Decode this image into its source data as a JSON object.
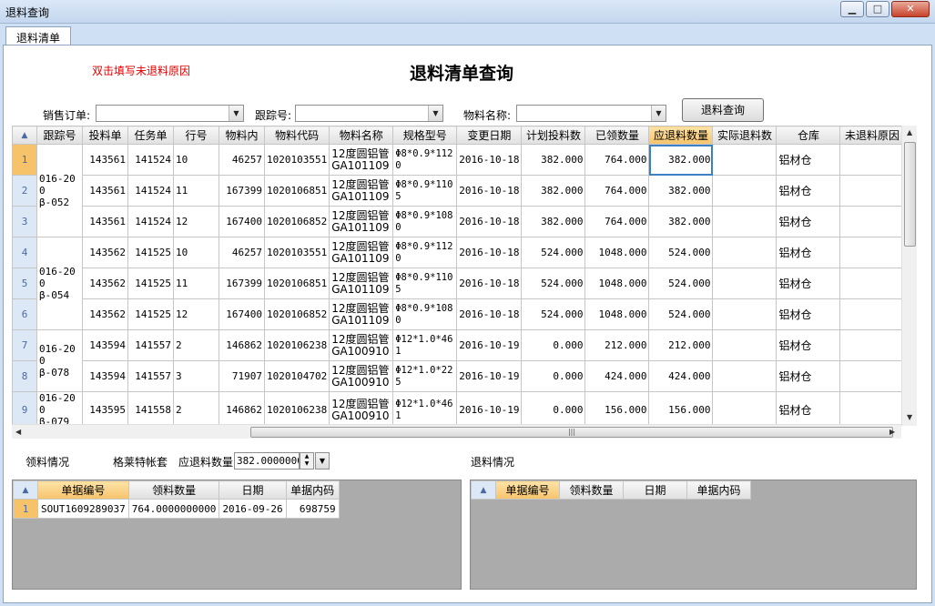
{
  "window": {
    "title": "退料查询"
  },
  "tabs": [
    {
      "label": "退料清单"
    }
  ],
  "hint_text": "双击填写未退料原因",
  "page_title": "退料清单查询",
  "filters": {
    "sales_order_label": "销售订单:",
    "sales_order_value": "",
    "tracking_label": "跟踪号:",
    "tracking_value": "",
    "material_name_label": "物料名称:",
    "material_name_value": "",
    "query_button": "退料查询"
  },
  "main_grid": {
    "columns": [
      "跟踪号",
      "投料单",
      "任务单",
      "行号",
      "物料内",
      "物料代码",
      "物料名称",
      "规格型号",
      "变更日期",
      "计划投料数",
      "已领数量",
      "应退料数量",
      "实际退料数",
      "仓库",
      "未退料原因"
    ],
    "groups": [
      {
        "tracking": "016-200\nβ-052",
        "row_start": 0,
        "span": 3
      },
      {
        "tracking": "016-200\nβ-054",
        "row_start": 3,
        "span": 3
      },
      {
        "tracking": "016-200\nβ-078",
        "row_start": 6,
        "span": 2
      },
      {
        "tracking": "016-200\nβ-079",
        "row_start": 8,
        "span": 1
      }
    ],
    "rows": [
      {
        "n": "1",
        "feed": "143561",
        "task": "141524",
        "line": "10",
        "inner": "46257",
        "code": "1020103551",
        "name": "12度圆铝管GA101109",
        "spec": "Φ8*0.9*1120",
        "date": "2016-10-18",
        "plan": "382.000",
        "taken": "764.000",
        "should": "382.000",
        "actual": "",
        "wh": "铝材仓",
        "reason": ""
      },
      {
        "n": "2",
        "feed": "143561",
        "task": "141524",
        "line": "11",
        "inner": "167399",
        "code": "1020106851",
        "name": "12度圆铝管GA101109",
        "spec": "Φ8*0.9*1105",
        "date": "2016-10-18",
        "plan": "382.000",
        "taken": "764.000",
        "should": "382.000",
        "actual": "",
        "wh": "铝材仓",
        "reason": ""
      },
      {
        "n": "3",
        "feed": "143561",
        "task": "141524",
        "line": "12",
        "inner": "167400",
        "code": "1020106852",
        "name": "12度圆铝管GA101109",
        "spec": "Φ8*0.9*1080",
        "date": "2016-10-18",
        "plan": "382.000",
        "taken": "764.000",
        "should": "382.000",
        "actual": "",
        "wh": "铝材仓",
        "reason": ""
      },
      {
        "n": "4",
        "feed": "143562",
        "task": "141525",
        "line": "10",
        "inner": "46257",
        "code": "1020103551",
        "name": "12度圆铝管GA101109",
        "spec": "Φ8*0.9*1120",
        "date": "2016-10-18",
        "plan": "524.000",
        "taken": "1048.000",
        "should": "524.000",
        "actual": "",
        "wh": "铝材仓",
        "reason": ""
      },
      {
        "n": "5",
        "feed": "143562",
        "task": "141525",
        "line": "11",
        "inner": "167399",
        "code": "1020106851",
        "name": "12度圆铝管GA101109",
        "spec": "Φ8*0.9*1105",
        "date": "2016-10-18",
        "plan": "524.000",
        "taken": "1048.000",
        "should": "524.000",
        "actual": "",
        "wh": "铝材仓",
        "reason": ""
      },
      {
        "n": "6",
        "feed": "143562",
        "task": "141525",
        "line": "12",
        "inner": "167400",
        "code": "1020106852",
        "name": "12度圆铝管GA101109",
        "spec": "Φ8*0.9*1080",
        "date": "2016-10-18",
        "plan": "524.000",
        "taken": "1048.000",
        "should": "524.000",
        "actual": "",
        "wh": "铝材仓",
        "reason": ""
      },
      {
        "n": "7",
        "feed": "143594",
        "task": "141557",
        "line": "2",
        "inner": "146862",
        "code": "1020106238",
        "name": "12度圆铝管GA100910",
        "spec": "Φ12*1.0*461",
        "date": "2016-10-19",
        "plan": "0.000",
        "taken": "212.000",
        "should": "212.000",
        "actual": "",
        "wh": "铝材仓",
        "reason": ""
      },
      {
        "n": "8",
        "feed": "143594",
        "task": "141557",
        "line": "3",
        "inner": "71907",
        "code": "1020104702",
        "name": "12度圆铝管GA100910",
        "spec": "Φ12*1.0*225",
        "date": "2016-10-19",
        "plan": "0.000",
        "taken": "424.000",
        "should": "424.000",
        "actual": "",
        "wh": "铝材仓",
        "reason": ""
      },
      {
        "n": "9",
        "feed": "143595",
        "task": "141558",
        "line": "2",
        "inner": "146862",
        "code": "1020106238",
        "name": "12度圆铝管GA100910",
        "spec": "Φ12*1.0*461",
        "date": "2016-10-19",
        "plan": "0.000",
        "taken": "156.000",
        "should": "156.000",
        "actual": "",
        "wh": "铝材仓",
        "reason": ""
      }
    ]
  },
  "lower": {
    "picking_label": "领料情况",
    "set_label": "格莱特帐套",
    "should_return_label": "应退料数量",
    "should_return_value": "382.0000000",
    "return_label": "退料情况"
  },
  "picking_grid": {
    "columns": [
      "单据编号",
      "领料数量",
      "日期",
      "单据内码"
    ],
    "rows": [
      {
        "n": "1",
        "no": "SOUT1609289037",
        "qty": "764.0000000000",
        "date": "2016-09-26",
        "inner": "698759"
      }
    ]
  },
  "return_grid": {
    "columns": [
      "单据编号",
      "领料数量",
      "日期",
      "单据内码"
    ]
  }
}
